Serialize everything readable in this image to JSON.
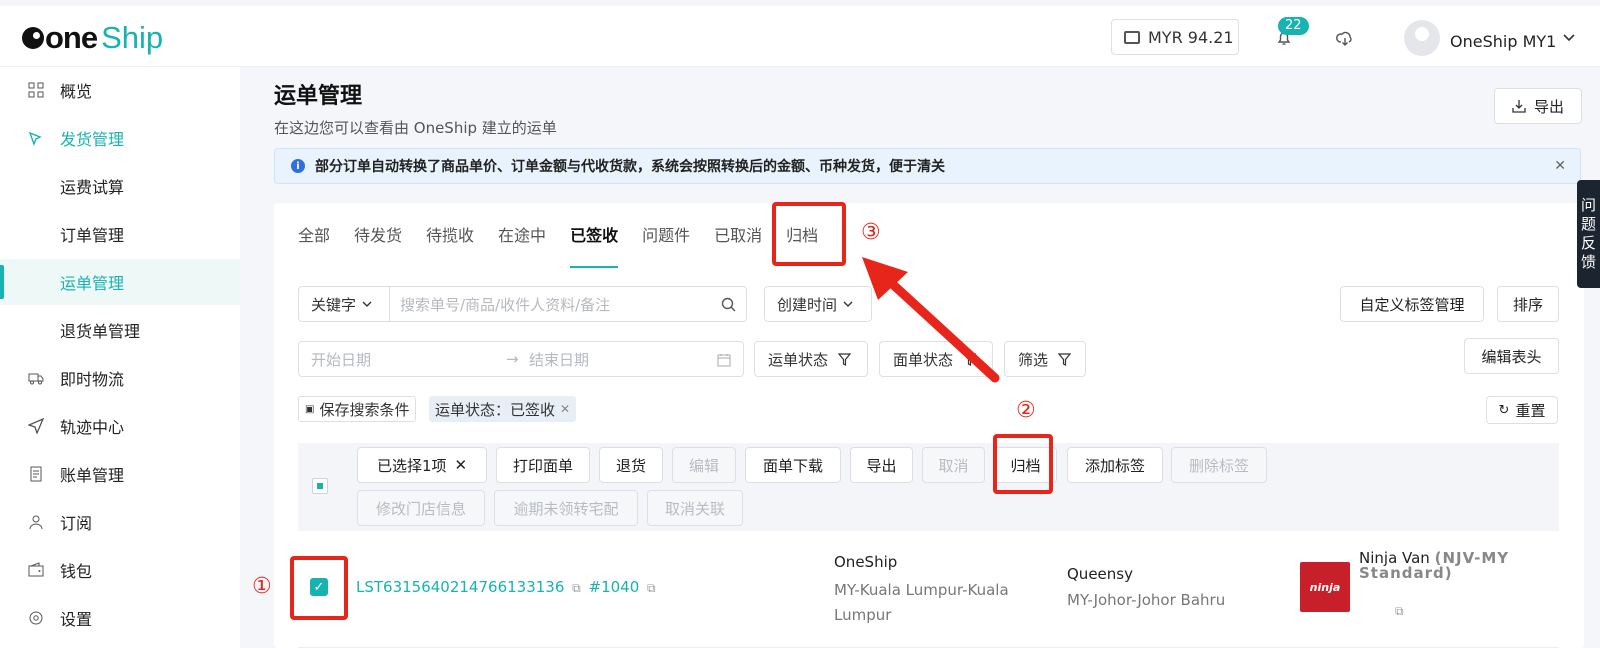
{
  "header": {
    "logo_one": "one",
    "logo_ship": "Ship",
    "wallet": "MYR 94.21",
    "notif_count": "22",
    "user": "OneShip MY1"
  },
  "sidebar": {
    "items": [
      {
        "label": "概览",
        "icon": "grid-icon"
      },
      {
        "label": "发货管理",
        "icon": "ship-icon"
      },
      {
        "label": "运费试算"
      },
      {
        "label": "订单管理"
      },
      {
        "label": "运单管理"
      },
      {
        "label": "退货单管理"
      },
      {
        "label": "即时物流",
        "icon": "truck-icon"
      },
      {
        "label": "轨迹中心",
        "icon": "send-icon"
      },
      {
        "label": "账单管理",
        "icon": "bill-icon"
      },
      {
        "label": "订阅",
        "icon": "user-icon"
      },
      {
        "label": "钱包",
        "icon": "wallet-icon"
      },
      {
        "label": "设置",
        "icon": "gear-icon"
      }
    ]
  },
  "page": {
    "title": "运单管理",
    "subtitle": "在这边您可以查看由 OneShip 建立的运单",
    "export": "导出",
    "notice": "部分订单自动转换了商品单价、订单金额与代收货款，系统会按照转换后的金额、币种发货，便于清关"
  },
  "tabs": [
    "全部",
    "待发货",
    "待揽收",
    "在途中",
    "已签收",
    "问题件",
    "已取消",
    "归档"
  ],
  "filters": {
    "keyword": "关键字",
    "search_placeholder": "搜索单号/商品/收件人资料/备注",
    "created_time": "创建时间",
    "custom_tags": "自定义标签管理",
    "sort": "排序",
    "start_date": "开始日期",
    "end_date": "结束日期",
    "waybill_status": "运单状态",
    "label_status": "面单状态",
    "filter": "筛选",
    "edit_header": "编辑表头",
    "save_search": "保存搜索条件",
    "active_chip": "运单状态：已签收",
    "reset": "重置"
  },
  "toolbar": {
    "selected": "已选择1项",
    "print": "打印面单",
    "return": "退货",
    "edit": "编辑",
    "download": "面单下载",
    "export": "导出",
    "cancel": "取消",
    "archive": "归档",
    "add_tag": "添加标签",
    "del_tag": "删除标签",
    "modify_store": "修改门店信息",
    "overdue": "逾期未领转宅配",
    "unlink": "取消关联"
  },
  "row": {
    "waybill": "LST6315640214766133136",
    "order": "#1040",
    "sender": "OneShip",
    "sender_addr": "MY-Kuala Lumpur-Kuala Lumpur",
    "receiver": "Queensy",
    "receiver_addr": "MY-Johor-Johor Bahru",
    "carrier": "Ninja Van",
    "carrier_code": "(NJV-MY Standard)",
    "carrier_logo": "ninja"
  },
  "annotations": {
    "one": "①",
    "two": "②",
    "three": "③"
  },
  "feedback": [
    "问",
    "题",
    "反",
    "馈"
  ]
}
